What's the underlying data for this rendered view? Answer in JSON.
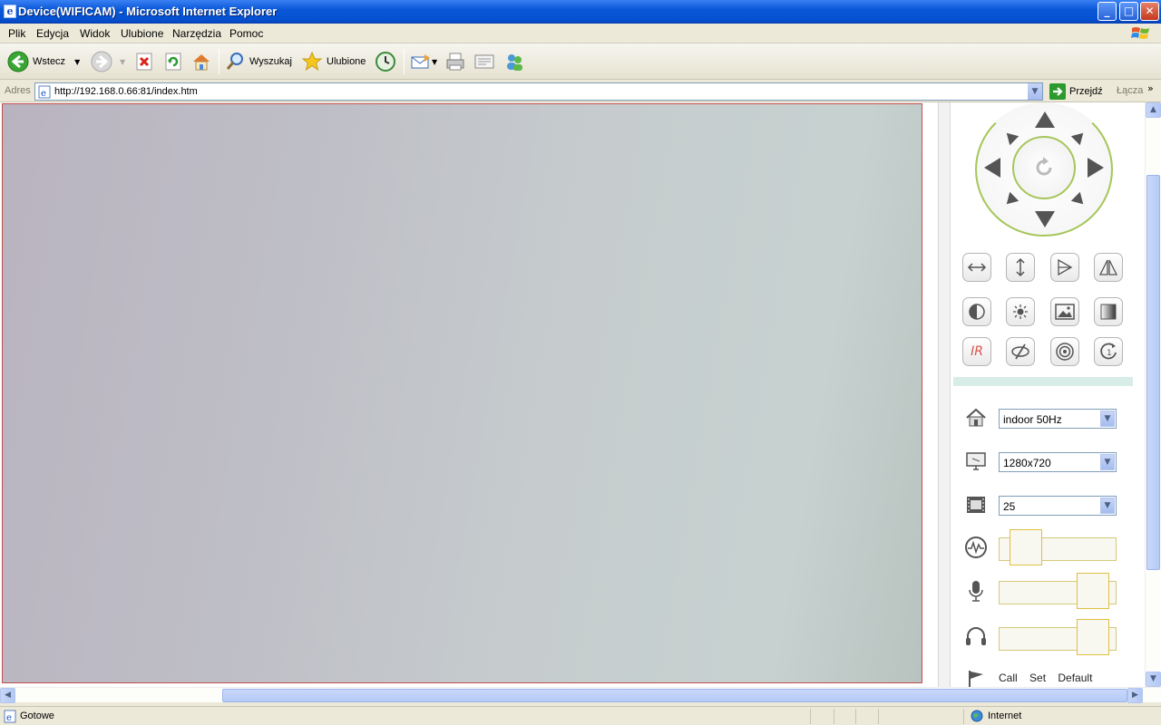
{
  "window": {
    "title": "Device(WIFICAM) - Microsoft Internet Explorer",
    "minimize": "_",
    "maximize": "□",
    "close": "✕"
  },
  "menu": [
    "Plik",
    "Edycja",
    "Widok",
    "Ulubione",
    "Narzędzia",
    "Pomoc"
  ],
  "toolbar": {
    "back_label": "Wstecz",
    "search_label": "Wyszukaj",
    "favorites_label": "Ulubione"
  },
  "address": {
    "label": "Adres",
    "url": "http://192.168.0.66:81/index.htm",
    "go_label": "Przejdź",
    "links_label": "Łącza"
  },
  "camera_panel": {
    "flip_buttons": [
      "horizontal-flip",
      "vertical-flip",
      "mirror",
      "mirror-vertical"
    ],
    "mode_select": "indoor 50Hz",
    "resolution_select": "1280x720",
    "framerate_select": "25",
    "buttons_row3": {
      "ir": "IR"
    },
    "preset": {
      "call": "Call",
      "set": "Set",
      "default": "Default"
    },
    "sliders": {
      "brightness": 0.2,
      "mic_volume": 0.9,
      "speaker_volume": 0.9
    }
  },
  "status": {
    "text": "Gotowe",
    "zone": "Internet"
  }
}
